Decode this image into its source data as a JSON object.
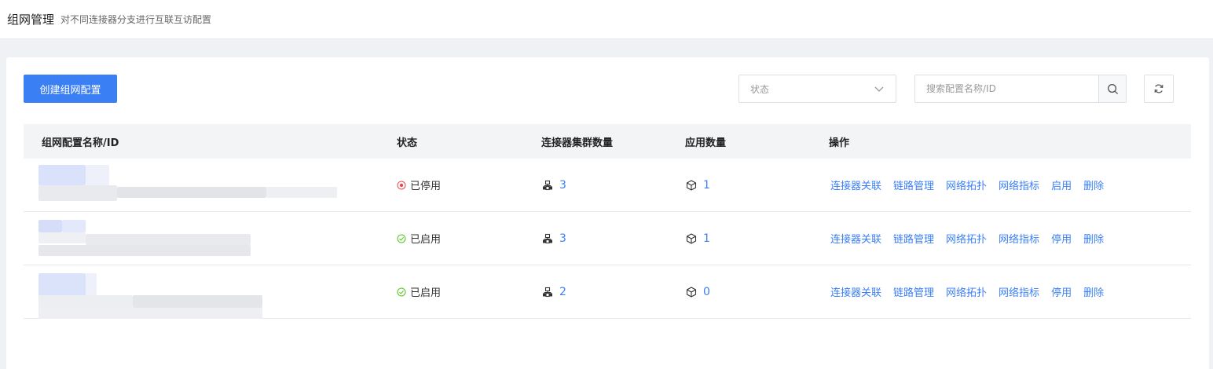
{
  "header": {
    "title": "组网管理",
    "subtitle": "对不同连接器分支进行互联互访配置"
  },
  "toolbar": {
    "create_label": "创建组网配置",
    "status_placeholder": "状态",
    "search_placeholder": "搜索配置名称/ID"
  },
  "table": {
    "columns": [
      "组网配置名称/ID",
      "状态",
      "连接器集群数量",
      "应用数量",
      "操作"
    ],
    "rows": [
      {
        "status": "已停用",
        "status_type": "disabled",
        "cluster_count": "3",
        "app_count": "1",
        "actions": [
          "连接器关联",
          "链路管理",
          "网络拓扑",
          "网络指标",
          "启用",
          "删除"
        ]
      },
      {
        "status": "已启用",
        "status_type": "enabled",
        "cluster_count": "3",
        "app_count": "1",
        "actions": [
          "连接器关联",
          "链路管理",
          "网络拓扑",
          "网络指标",
          "停用",
          "删除"
        ]
      },
      {
        "status": "已启用",
        "status_type": "enabled",
        "cluster_count": "2",
        "app_count": "0",
        "actions": [
          "连接器关联",
          "链路管理",
          "网络拓扑",
          "网络指标",
          "停用",
          "删除"
        ]
      }
    ]
  },
  "colors": {
    "primary": "#3b7ff4",
    "disabled": "#e5484d",
    "enabled": "#52c41a"
  },
  "icons": {
    "status_disabled": "stop-circle-icon",
    "status_enabled": "check-circle-icon",
    "cluster": "cluster-icon",
    "app": "cube-icon",
    "search": "search-icon",
    "refresh": "refresh-icon",
    "dropdown": "chevron-down-icon"
  }
}
